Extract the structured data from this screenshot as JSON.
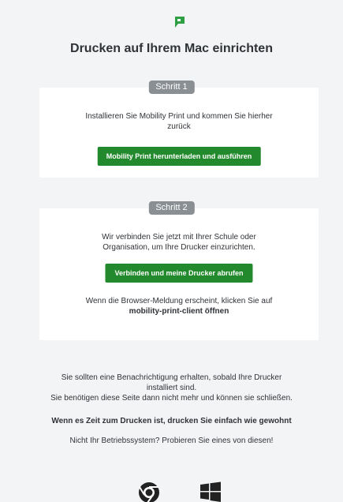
{
  "page": {
    "title": "Drucken auf Ihrem Mac einrichten"
  },
  "step1": {
    "badge": "Schritt 1",
    "text_line1": "Installieren Sie Mobility Print und kommen Sie hierher",
    "text_line2": "zurück",
    "button_label": "Mobility Print herunterladen und ausführen"
  },
  "step2": {
    "badge": "Schritt 2",
    "text_line1": "Wir verbinden Sie jetzt mit Ihrer Schule oder",
    "text_line2": "Organisation, um Ihre Drucker einzurichten.",
    "button_label": "Verbinden und meine Drucker abrufen",
    "hint_line1": "Wenn die Browser-Meldung erscheint, klicken Sie auf",
    "hint_line2": "mobility-print-client öffnen"
  },
  "footer": {
    "notice_line1": "Sie sollten eine Benachrichtigung erhalten, sobald Ihre Drucker",
    "notice_line2": "installiert sind.",
    "notice_line3": "Sie benötigen diese Seite dann nicht mehr und können sie schließen.",
    "print_hint": "Wenn es Zeit zum Drucken ist, drucken Sie einfach wie gewohnt",
    "other_os": "Nicht Ihr Betriebssystem? Probieren Sie eines von diesen!"
  },
  "icons": {
    "logo": "papercut-logo-icon",
    "chrome": "chrome-os-icon",
    "windows": "windows-icon"
  },
  "colors": {
    "accent": "#228a2c",
    "badge": "#8a8f93",
    "background": "#f3f4f6"
  }
}
